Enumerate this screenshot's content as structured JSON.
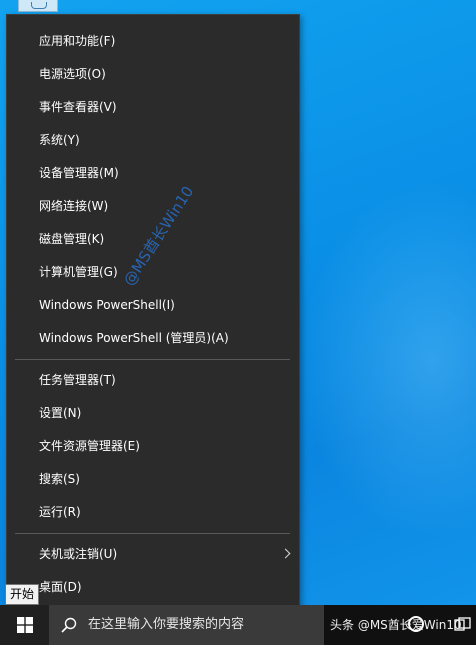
{
  "menu": {
    "items": [
      {
        "label": "应用和功能(F)"
      },
      {
        "label": "电源选项(O)"
      },
      {
        "label": "事件查看器(V)"
      },
      {
        "label": "系统(Y)"
      },
      {
        "label": "设备管理器(M)"
      },
      {
        "label": "网络连接(W)"
      },
      {
        "label": "磁盘管理(K)"
      },
      {
        "label": "计算机管理(G)"
      },
      {
        "label": "Windows PowerShell(I)"
      },
      {
        "label": "Windows PowerShell (管理员)(A)"
      },
      {
        "label": "任务管理器(T)"
      },
      {
        "label": "设置(N)"
      },
      {
        "label": "文件资源管理器(E)"
      },
      {
        "label": "搜索(S)"
      },
      {
        "label": "运行(R)"
      },
      {
        "label": "关机或注销(U)"
      },
      {
        "label": "桌面(D)"
      }
    ]
  },
  "watermark": "@MS酋长Win10",
  "tooltip": "开始",
  "taskbar": {
    "search_placeholder": "在这里输入你要搜索的内容",
    "credit": "头条 @MS酋长爱Win10"
  },
  "icons": {
    "start": "windows-logo-icon",
    "search": "magnifier-icon",
    "cortana": "cortana-ring-icon",
    "task_view": "task-view-icon",
    "submenu": "chevron-right-icon"
  },
  "colors": {
    "menu_bg": "#2b2b2b",
    "taskbar_bg": "#101010",
    "desktop_bg": "#0a8fe6"
  }
}
